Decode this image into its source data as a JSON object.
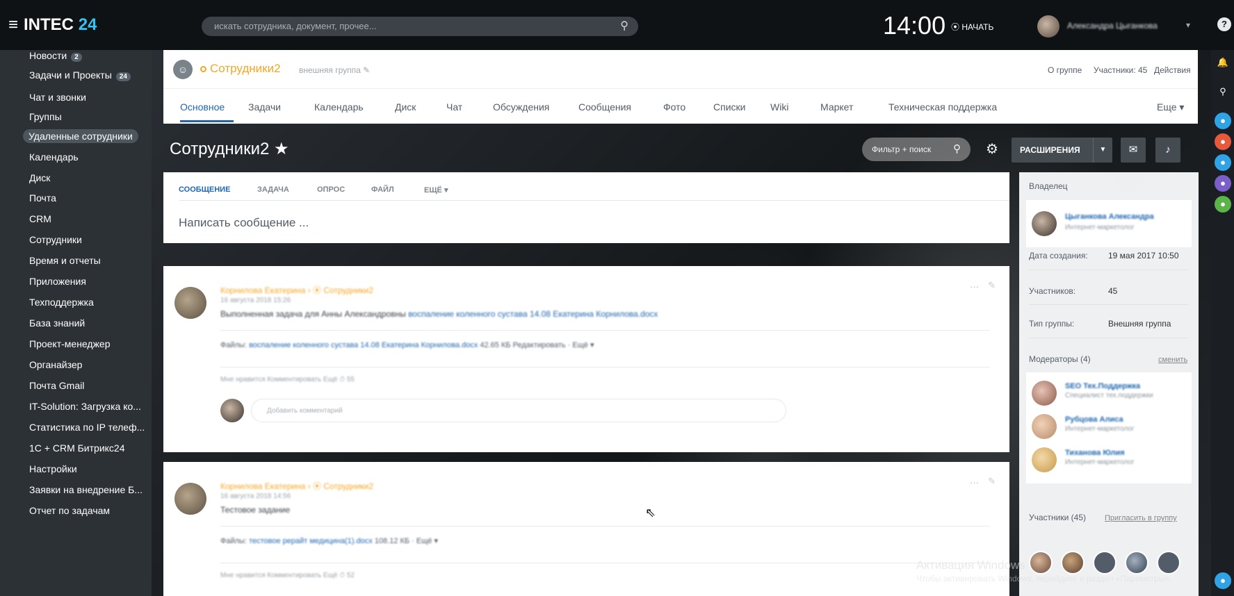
{
  "topbar": {
    "menu_glyph": "≡",
    "logo_text": "INTEC",
    "logo_num": "24",
    "search_placeholder": "искать сотрудника, документ, прочее...",
    "time": "14:00",
    "start_label": "⦿ НАЧАТЬ",
    "user_name": "Александра Цыганкова",
    "help_glyph": "?"
  },
  "sidebar": {
    "items": [
      {
        "label": "Новости",
        "badge": "2"
      },
      {
        "label": "Задачи и Проекты",
        "badge": "24"
      },
      {
        "label": "Чат и звонки",
        "badge": ""
      },
      {
        "label": "Группы",
        "badge": ""
      },
      {
        "label": "Удаленные сотрудники",
        "badge": ""
      },
      {
        "label": "Календарь",
        "badge": ""
      },
      {
        "label": "Диск",
        "badge": ""
      },
      {
        "label": "Почта",
        "badge": ""
      },
      {
        "label": "CRM",
        "badge": ""
      },
      {
        "label": "Сотрудники",
        "badge": ""
      },
      {
        "label": "Время и отчеты",
        "badge": ""
      },
      {
        "label": "Приложения",
        "badge": ""
      },
      {
        "label": "Техподдержка",
        "badge": ""
      },
      {
        "label": "База знаний",
        "badge": ""
      },
      {
        "label": "Проект-менеджер",
        "badge": ""
      },
      {
        "label": "Органайзер",
        "badge": ""
      },
      {
        "label": "Почта Gmail",
        "badge": ""
      },
      {
        "label": "IT-Solution: Загрузка ко...",
        "badge": ""
      },
      {
        "label": "Статистика по IP телеф...",
        "badge": ""
      },
      {
        "label": "1С + CRM Битрикс24",
        "badge": ""
      },
      {
        "label": "Настройки",
        "badge": ""
      },
      {
        "label": "Заявки на внедрение Б...",
        "badge": ""
      },
      {
        "label": "Отчет по задачам",
        "badge": ""
      }
    ]
  },
  "group": {
    "title": "Сотрудники2",
    "type": "внешняя группа ✎",
    "about": "О группе",
    "members": "Участники: 45",
    "actions": "Действия",
    "tabs": [
      "Основное",
      "Задачи",
      "Календарь",
      "Диск",
      "Чат",
      "Обсуждения",
      "Сообщения",
      "Фото",
      "Списки",
      "Wiki",
      "Маркет",
      "Техническая поддержка",
      "Еще ▾"
    ]
  },
  "page": {
    "title": "Сотрудники2 ★",
    "filter_placeholder": "Фильтр + поиск",
    "extensions_label": "РАСШИРЕНИЯ"
  },
  "composer": {
    "tabs": [
      "СООБЩЕНИЕ",
      "ЗАДАЧА",
      "ОПРОС",
      "ФАЙЛ",
      "ЕЩЁ ▾"
    ],
    "placeholder": "Написать сообщение ..."
  },
  "posts": [
    {
      "author": "Корнилова Екатерина › ⦿ Сотрудники2",
      "date": "16 августа 2018 15:26",
      "text": "Выполненная задача для Анны Александровны",
      "text_link": "воспаление коленного сустава 14.08 Екатерина Корнилова.docx",
      "files_label": "Файлы:",
      "files_link": "воспаление коленного сустава 14.08 Екатерина Корнилова.docx",
      "files_meta": "42.65 КБ Редактировать · Ещё ▾",
      "actions": "Мне нравится   Комментировать   Ещё   ⏱ 55",
      "comment_placeholder": "Добавить комментарий"
    },
    {
      "author": "Корнилова Екатерина › ⦿ Сотрудники2",
      "date": "16 августа 2018 14:56",
      "text": "Тестовое задание",
      "text_link": "",
      "files_label": "Файлы:",
      "files_link": "тестовое рерайт медицина(1).docx",
      "files_meta": "108.12 КБ · Ещё ▾",
      "actions": "Мне нравится   Комментировать   Ещё   ⏱ 52",
      "comment_placeholder": ""
    }
  ],
  "info": {
    "owner_label": "Владелец",
    "owner_name": "Цыганкова Александра",
    "owner_role": "Интернет-маркетолог",
    "created_label": "Дата создания:",
    "created_value": "19 мая 2017 10:50",
    "members_label": "Участников:",
    "members_value": "45",
    "type_label": "Тип группы:",
    "type_value": "Внешняя группа",
    "moderators_label": "Модераторы (4)",
    "change_link": "сменить",
    "moderators": [
      {
        "name": "SEO Тех.Поддержка",
        "role": "Специалист тех.поддержки"
      },
      {
        "name": "Рубцова Алиса",
        "role": "Интернет-маркетолог"
      },
      {
        "name": "Тиханова Юлия",
        "role": "Интернет-маркетолог"
      }
    ],
    "participants_label": "Участники (45)",
    "invite_link": "Пригласить в группу"
  },
  "watermark": {
    "line1": "Активация Windows",
    "line2": "Чтобы активировать Windows, перейдите в раздел «Параметры»."
  },
  "colors": {
    "accent": "#2067b0",
    "group_orange": "#f5a623",
    "sidebar_bg": "#2c3136"
  }
}
